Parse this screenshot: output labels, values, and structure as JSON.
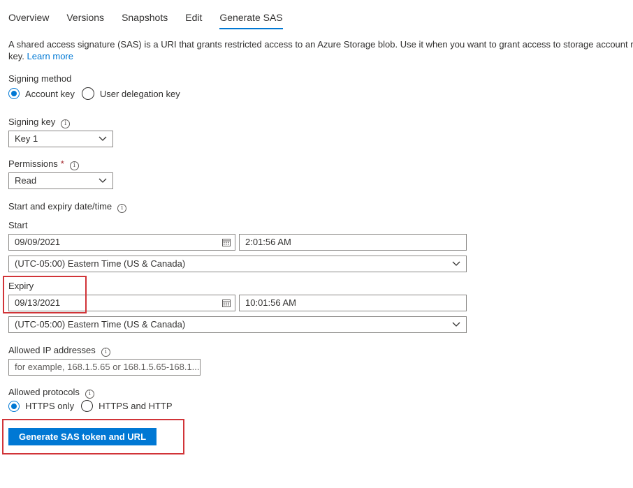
{
  "tabs": [
    {
      "label": "Overview"
    },
    {
      "label": "Versions"
    },
    {
      "label": "Snapshots"
    },
    {
      "label": "Edit"
    },
    {
      "label": "Generate SAS",
      "active": true
    }
  ],
  "description": {
    "text1": "A shared access signature (SAS) is a URI that grants restricted access to an Azure Storage blob. Use it when you want to grant access to storage account resc",
    "text2": "key. ",
    "learn_more": "Learn more"
  },
  "signing_method": {
    "label": "Signing method",
    "options": [
      "Account key",
      "User delegation key"
    ],
    "selected": "Account key"
  },
  "signing_key": {
    "label": "Signing key",
    "value": "Key 1"
  },
  "permissions": {
    "label": "Permissions",
    "required_mark": "*",
    "value": "Read"
  },
  "datetime": {
    "label": "Start and expiry date/time",
    "start": {
      "label": "Start",
      "date": "09/09/2021",
      "time": "2:01:56 AM",
      "timezone": "(UTC-05:00) Eastern Time (US & Canada)"
    },
    "expiry": {
      "label": "Expiry",
      "date": "09/13/2021",
      "time": "10:01:56 AM",
      "timezone": "(UTC-05:00) Eastern Time (US & Canada)"
    }
  },
  "allowed_ip": {
    "label": "Allowed IP addresses",
    "placeholder": "for example, 168.1.5.65 or 168.1.5.65-168.1...."
  },
  "allowed_protocols": {
    "label": "Allowed protocols",
    "options": [
      "HTTPS only",
      "HTTPS and HTTP"
    ],
    "selected": "HTTPS only"
  },
  "generate_button": "Generate SAS token and URL",
  "colors": {
    "accent": "#0078d4",
    "highlight": "#d13438",
    "required": "#a4262c"
  }
}
